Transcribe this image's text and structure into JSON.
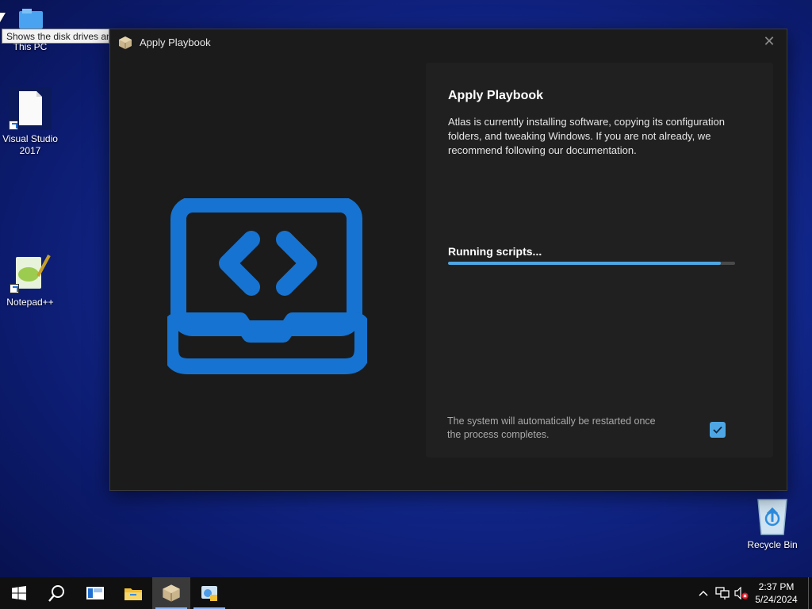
{
  "desktop": {
    "icons": [
      {
        "label": "This PC"
      },
      {
        "label": "Visual Studio 2017"
      },
      {
        "label": "Notepad++"
      },
      {
        "label": "Recycle Bin"
      }
    ],
    "tooltip": "Shows the disk drives and hardware"
  },
  "dialog": {
    "title": "Apply Playbook",
    "heading": "Apply Playbook",
    "description": "Atlas is currently installing software, copying its configuration folders, and tweaking Windows. If you are not already, we recommend following our documentation.",
    "status": "Running scripts...",
    "progress_percent": 95,
    "restart_note": "The system will automatically be restarted once the process completes.",
    "restart_checked": true,
    "close_symbol": "✕",
    "hero_icon": "laptop-code-icon",
    "accent_color": "#4ea7e4",
    "hero_color": "#1673d1"
  },
  "taskbar": {
    "items": [
      "start-icon",
      "search-icon",
      "task-view-icon",
      "file-explorer-icon",
      "atlas-installer-icon",
      "control-panel-icon"
    ],
    "clock_time": "2:37 PM",
    "clock_date": "5/24/2024"
  }
}
